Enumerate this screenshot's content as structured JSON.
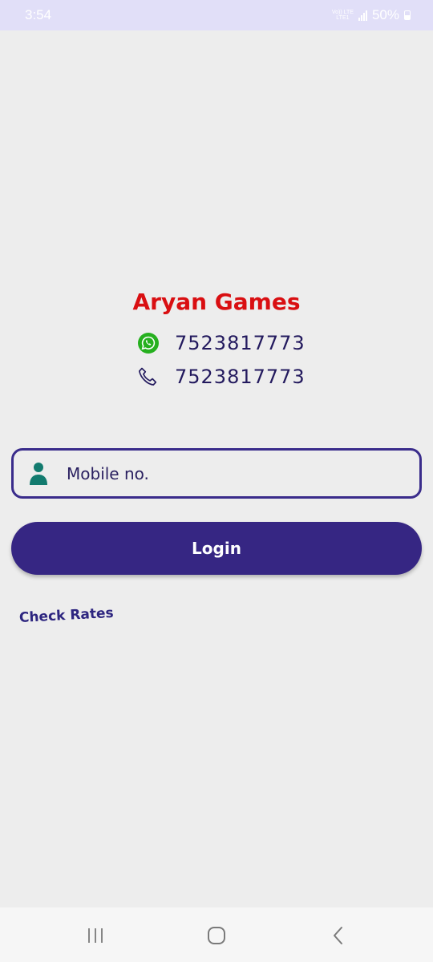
{
  "status_bar": {
    "time": "3:54",
    "network_line1": "Vo)) LTE",
    "network_line2": "LTE1",
    "battery": "50%"
  },
  "app": {
    "title": "Aryan Games",
    "whatsapp_number": "7523817773",
    "phone_number": "7523817773",
    "icons": {
      "whatsapp": "whatsapp-icon",
      "phone": "phone-icon",
      "user": "user-icon"
    }
  },
  "login_form": {
    "mobile_placeholder": "Mobile no.",
    "mobile_value": "",
    "login_label": "Login",
    "check_rates_label": "Check Rates"
  },
  "colors": {
    "title": "#d90f12",
    "primary": "#362683",
    "whatsapp": "#26b01f",
    "user_icon": "#137b6f"
  },
  "nav_bar": {
    "recents": "recents-icon",
    "home": "home-icon",
    "back": "back-icon"
  }
}
